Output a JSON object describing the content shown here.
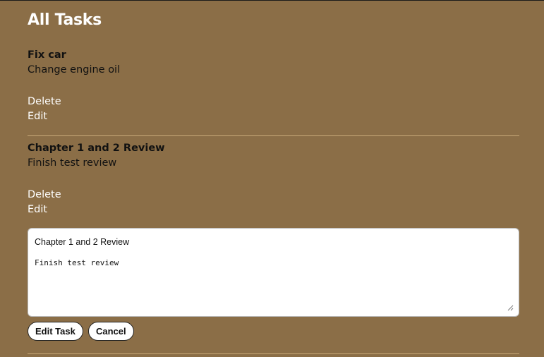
{
  "page": {
    "title": "All Tasks"
  },
  "tasks": [
    {
      "title": "Fix car",
      "description": "Change engine oil",
      "delete_label": "Delete",
      "edit_label": "Edit"
    },
    {
      "title": "Chapter 1 and 2 Review",
      "description": "Finish test review",
      "delete_label": "Delete",
      "edit_label": "Edit"
    }
  ],
  "edit_form": {
    "title_value": "Chapter 1 and 2 Review",
    "description_value": "Finish test review",
    "submit_label": "Edit Task",
    "cancel_label": "Cancel"
  },
  "colors": {
    "background": "#8b6e47",
    "divider": "#c9a97a",
    "link": "#ffffff"
  }
}
